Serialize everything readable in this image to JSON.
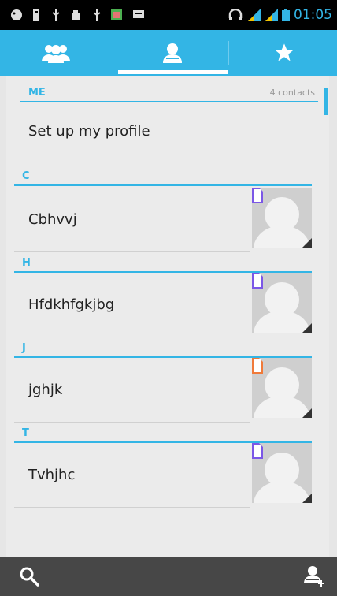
{
  "status_bar": {
    "time": "01:05",
    "colors": {
      "time": "#33b5e5",
      "signal": "#33b5e5"
    },
    "icons": [
      "android-debug-icon",
      "sd-card-icon",
      "usb-icon",
      "android-icon",
      "usb-icon",
      "gallery-icon",
      "message-icon",
      "headset-icon",
      "signal-icon",
      "signal-icon",
      "battery-icon"
    ]
  },
  "tabs": [
    {
      "name": "groups",
      "icon": "groups-icon",
      "selected": false
    },
    {
      "name": "all-contacts",
      "icon": "person-icon",
      "selected": true
    },
    {
      "name": "favorites",
      "icon": "star-icon",
      "selected": false
    }
  ],
  "me_section": {
    "label": "ME",
    "count": "4 contacts",
    "profile_text": "Set up my profile"
  },
  "sections": [
    {
      "letter": "C",
      "contact": "Cbhvvj",
      "sim_color": "#7b57e6"
    },
    {
      "letter": "H",
      "contact": "Hfdkhfgkjbg",
      "sim_color": "#7b57e6"
    },
    {
      "letter": "J",
      "contact": "jghjk",
      "sim_color": "#f07a3a"
    },
    {
      "letter": "T",
      "contact": "Tvhjhc",
      "sim_color": "#7b57e6"
    }
  ],
  "bottom_bar": {
    "left_icon": "search-icon",
    "right_icon": "add-contact-icon"
  },
  "accent": "#33b5e5"
}
